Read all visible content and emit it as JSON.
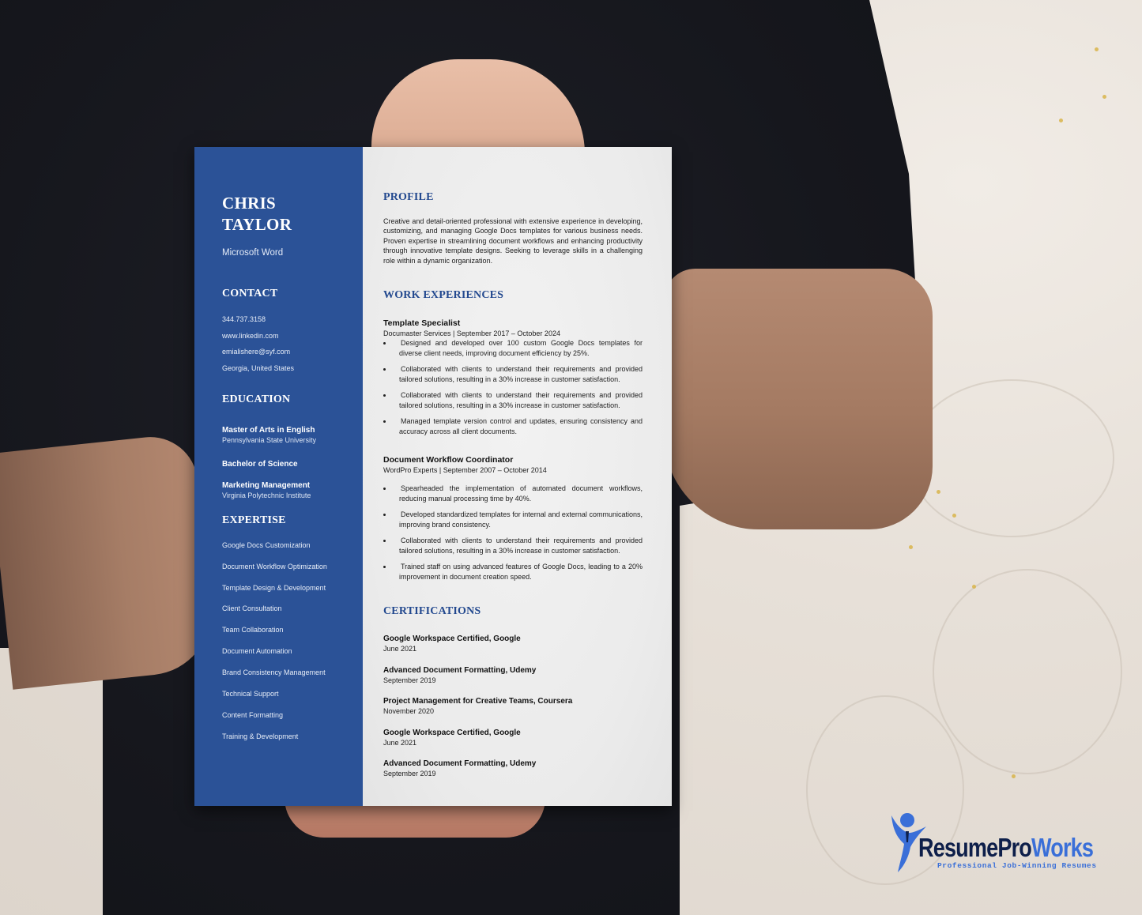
{
  "colors": {
    "sidebar": "#2b5297",
    "heading_accent": "#23498f",
    "logo_dark": "#0e1f4a",
    "logo_light": "#3a6fd8"
  },
  "resume": {
    "name_line1": "CHRIS",
    "name_line2": "TAYLOR",
    "role": "Microsoft Word",
    "contact": {
      "heading": "CONTACT",
      "items": [
        "344.737.3158",
        "www.linkedin.com",
        "emialishere@syf.com",
        "Georgia, United States"
      ]
    },
    "education": {
      "heading": "EDUCATION",
      "items": [
        {
          "degree": "Master of Arts in English",
          "school": "Pennsylvania State University"
        },
        {
          "degree": "Bachelor of Science",
          "school": ""
        },
        {
          "degree": "Marketing Management",
          "school": "Virginia Polytechnic Institute"
        }
      ]
    },
    "expertise": {
      "heading": "EXPERTISE",
      "items": [
        "Google Docs Customization",
        "Document Workflow Optimization",
        "Template Design & Development",
        "Client Consultation",
        "Team Collaboration",
        "Document Automation",
        "Brand Consistency Management",
        "Technical Support",
        "Content Formatting",
        "Training & Development"
      ]
    },
    "profile": {
      "heading": "PROFILE",
      "text": "Creative and detail-oriented professional with extensive experience in developing, customizing, and managing Google Docs templates for various business needs. Proven expertise in streamlining document workflows and enhancing productivity through innovative template designs. Seeking to leverage skills in a challenging role within a dynamic organization."
    },
    "work": {
      "heading": "WORK EXPERIENCES",
      "jobs": [
        {
          "title": "Template Specialist",
          "meta": "Documaster Services | September 2017 – October 2024",
          "bullets": [
            "Designed and developed over 100 custom Google Docs templates for diverse client needs, improving document efficiency by 25%.",
            "Collaborated with clients to understand their requirements and provided tailored solutions, resulting in a 30% increase in customer satisfaction.",
            "Collaborated with clients to understand their requirements and provided tailored solutions, resulting in a 30% increase in customer satisfaction.",
            "Managed template version control and updates, ensuring consistency and accuracy across all client documents."
          ]
        },
        {
          "title": "Document Workflow Coordinator",
          "meta": "WordPro Experts | September 2007 – October 2014",
          "bullets": [
            "Spearheaded the implementation of automated document workflows, reducing manual processing time by 40%.",
            "Developed standardized templates for internal and external communications, improving brand consistency.",
            "Collaborated with clients to understand their requirements and provided tailored solutions, resulting in a 30% increase in customer satisfaction.",
            "Trained staff on using advanced features of Google Docs, leading to a 20% improvement in document creation speed."
          ]
        }
      ]
    },
    "certifications": {
      "heading": "CERTIFICATIONS",
      "items": [
        {
          "title": "Google Workspace Certified, Google",
          "date": "June 2021"
        },
        {
          "title": "Advanced Document Formatting, Udemy",
          "date": "September 2019"
        },
        {
          "title": "Project Management for Creative Teams, Coursera",
          "date": "November 2020"
        },
        {
          "title": "Google Workspace Certified, Google",
          "date": "June 2021"
        },
        {
          "title": "Advanced Document Formatting, Udemy",
          "date": "September 2019"
        }
      ]
    }
  },
  "logo": {
    "word_dark": "ResumePro",
    "word_light": "Works",
    "tagline": "Professional Job-Winning Resumes",
    "icon": "person-raising-arm-icon"
  }
}
